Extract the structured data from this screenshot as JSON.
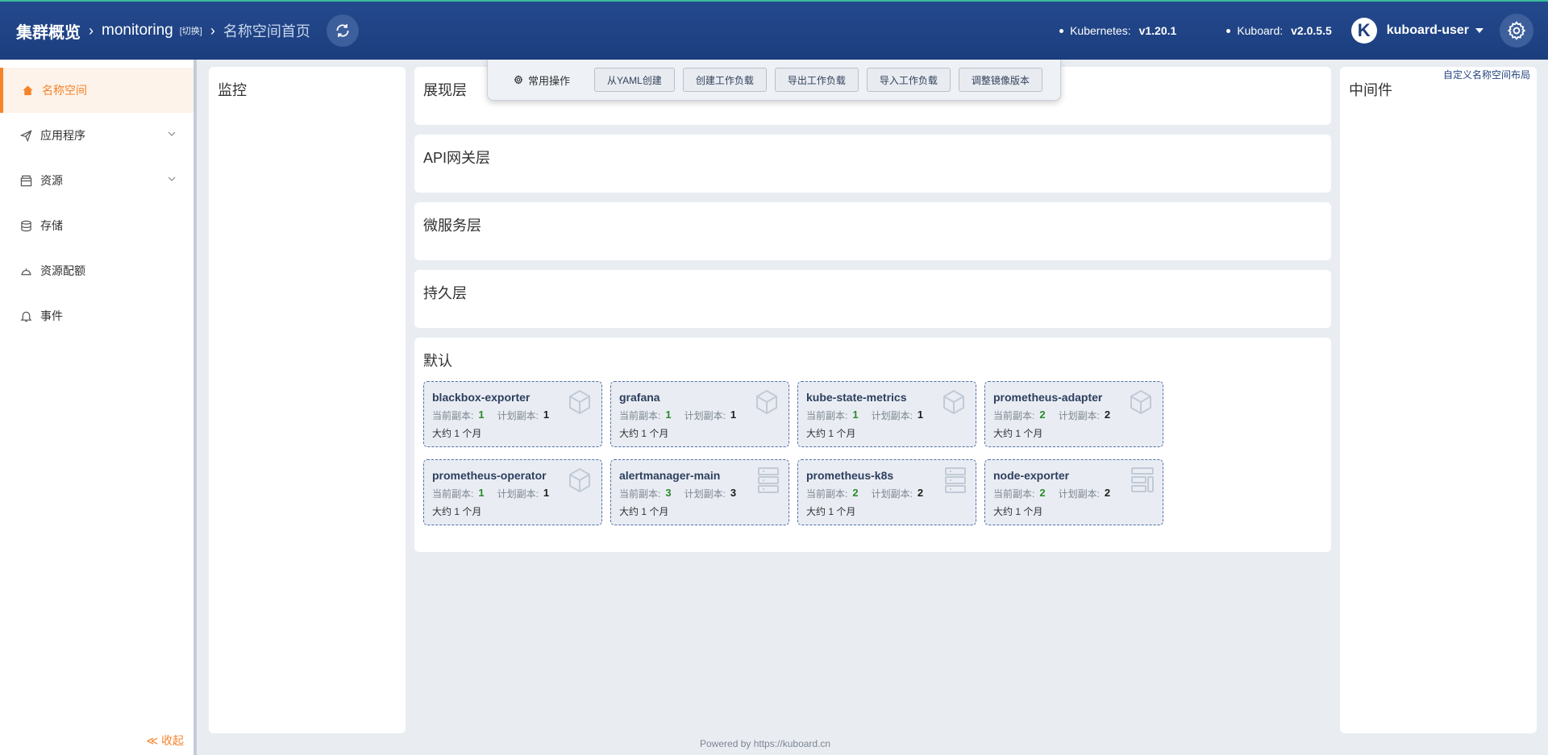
{
  "header": {
    "cluster_label": "集群概览",
    "namespace": "monitoring",
    "switch_label": "[切换]",
    "page_label": "名称空间首页",
    "k8s_label": "Kubernetes:",
    "k8s_version": "v1.20.1",
    "kuboard_label": "Kuboard:",
    "kuboard_version": "v2.0.5.5",
    "avatar_letter": "K",
    "username": "kuboard-user"
  },
  "sidebar": {
    "items": [
      {
        "label": "名称空间",
        "icon": "home-icon"
      },
      {
        "label": "应用程序",
        "icon": "send-icon"
      },
      {
        "label": "资源",
        "icon": "box-icon"
      },
      {
        "label": "存储",
        "icon": "database-icon"
      },
      {
        "label": "资源配额",
        "icon": "dish-icon"
      },
      {
        "label": "事件",
        "icon": "bell-icon"
      }
    ],
    "collapse_label": "≪ 收起"
  },
  "ops": {
    "label": "常用操作",
    "buttons": [
      "从YAML创建",
      "创建工作负载",
      "导出工作负载",
      "导入工作负载",
      "调整镜像版本"
    ]
  },
  "custom_layout_link": "自定义名称空间布局",
  "panels": {
    "monitor": "监控",
    "presentation": "展现层",
    "api_gateway": "API网关层",
    "microservice": "微服务层",
    "persistence": "持久层",
    "default": "默认",
    "middleware": "中间件"
  },
  "cards": [
    {
      "name": "blackbox-exporter",
      "cur_label": "当前副本:",
      "cur": "1",
      "plan_label": "计划副本:",
      "plan": "1",
      "age": "大约 1 个月",
      "icon": "cube-icon"
    },
    {
      "name": "grafana",
      "cur_label": "当前副本:",
      "cur": "1",
      "plan_label": "计划副本:",
      "plan": "1",
      "age": "大约 1 个月",
      "icon": "cube-icon"
    },
    {
      "name": "kube-state-metrics",
      "cur_label": "当前副本:",
      "cur": "1",
      "plan_label": "计划副本:",
      "plan": "1",
      "age": "大约 1 个月",
      "icon": "cube-icon"
    },
    {
      "name": "prometheus-adapter",
      "cur_label": "当前副本:",
      "cur": "2",
      "plan_label": "计划副本:",
      "plan": "2",
      "age": "大约 1 个月",
      "icon": "cube-icon"
    },
    {
      "name": "prometheus-operator",
      "cur_label": "当前副本:",
      "cur": "1",
      "plan_label": "计划副本:",
      "plan": "1",
      "age": "大约 1 个月",
      "icon": "cube-icon"
    },
    {
      "name": "alertmanager-main",
      "cur_label": "当前副本:",
      "cur": "3",
      "plan_label": "计划副本:",
      "plan": "3",
      "age": "大约 1 个月",
      "icon": "statefulset-icon"
    },
    {
      "name": "prometheus-k8s",
      "cur_label": "当前副本:",
      "cur": "2",
      "plan_label": "计划副本:",
      "plan": "2",
      "age": "大约 1 个月",
      "icon": "statefulset-icon"
    },
    {
      "name": "node-exporter",
      "cur_label": "当前副本:",
      "cur": "2",
      "plan_label": "计划副本:",
      "plan": "2",
      "age": "大约 1 个月",
      "icon": "daemonset-icon"
    }
  ],
  "footer": "Powered by https://kuboard.cn"
}
